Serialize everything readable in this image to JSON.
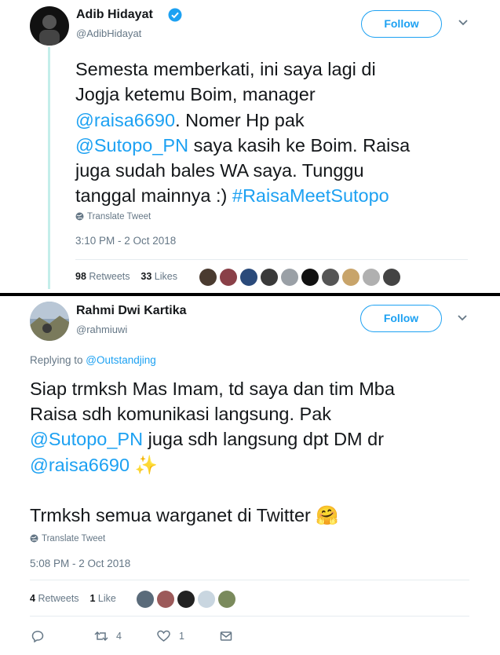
{
  "tweet1": {
    "name": "Adib Hidayat",
    "handle": "@AdibHidayat",
    "follow_label": "Follow",
    "text": {
      "l1": "Semesta memberkati, ini saya lagi di",
      "l2": "Jogja ketemu Boim, manager",
      "mention1": "@raisa6690",
      "l3_rest": ". Nomer Hp pak",
      "mention2": "@Sutopo_PN",
      "l4_rest": " saya kasih ke Boim. Raisa",
      "l5": "juga sudah bales WA saya. Tunggu",
      "l6_pre": "tanggal mainnya :) ",
      "hashtag": "#RaisaMeetSutopo"
    },
    "translate": "Translate Tweet",
    "timestamp": "3:10 PM - 2 Oct 2018",
    "retweets_count": "98",
    "retweets_label": "Retweets",
    "likes_count": "33",
    "likes_label": "Likes"
  },
  "tweet2": {
    "name": "Rahmi Dwi Kartika",
    "handle": "@rahmiuwi",
    "follow_label": "Follow",
    "replying_prefix": "Replying to ",
    "replying_to": "@Outstandjing",
    "text": {
      "l1": "Siap trmksh Mas Imam, td saya dan tim Mba",
      "l2": "Raisa sdh komunikasi langsung. Pak",
      "mention1": "@Sutopo_PN",
      "l3_rest": " juga sdh langsung dpt DM dr",
      "mention2": "@raisa6690",
      "l4_emoji": "✨",
      "l5": "Trmksh semua warganet di Twitter ",
      "l5_emoji": "🤗"
    },
    "translate": "Translate Tweet",
    "timestamp": "5:08 PM - 2 Oct 2018",
    "retweets_count": "4",
    "retweets_label": "Retweets",
    "likes_count": "1",
    "likes_label": "Like",
    "actions": {
      "retweet_count": "4",
      "like_count": "1"
    }
  },
  "icons": {
    "verified": "verified-badge-icon",
    "chevron": "chevron-down-icon",
    "globe": "globe-icon",
    "reply": "reply-icon",
    "retweet": "retweet-icon",
    "like": "heart-icon",
    "message": "envelope-icon"
  },
  "colors": {
    "accent": "#1da1f2",
    "thread_line": "#c4eeea",
    "text": "#14171a",
    "muted": "#657786",
    "separator": "#000000"
  }
}
